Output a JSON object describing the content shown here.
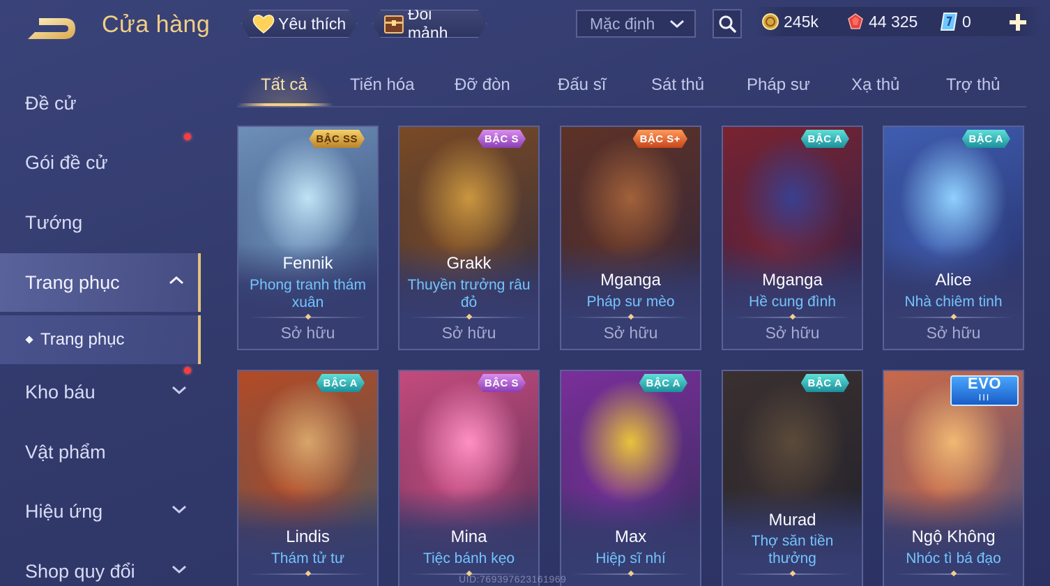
{
  "header": {
    "title": "Cửa hàng",
    "favorite_label": "Yêu thích",
    "shard_exchange_label": "Đổi mảnh",
    "sort_select_value": "Mặc định",
    "currency": {
      "gold": "245k",
      "rubies": "44 325",
      "vouchers": "0"
    }
  },
  "sidebar": {
    "items": [
      {
        "label": "Đề cử"
      },
      {
        "label": "Gói đề cử"
      },
      {
        "label": "Tướng"
      },
      {
        "label": "Trang phục"
      },
      {
        "label": "Kho báu"
      },
      {
        "label": "Vật phẩm"
      },
      {
        "label": "Hiệu ứng"
      },
      {
        "label": "Shop quy đổi"
      }
    ],
    "sub_item": {
      "label": "Trang phục"
    }
  },
  "tabs": [
    {
      "label": "Tất cả",
      "active": true
    },
    {
      "label": "Tiến hóa"
    },
    {
      "label": "Đỡ đòn"
    },
    {
      "label": "Đấu sĩ"
    },
    {
      "label": "Sát thủ"
    },
    {
      "label": "Pháp sư"
    },
    {
      "label": "Xạ thủ"
    },
    {
      "label": "Trợ thủ"
    }
  ],
  "cards": [
    {
      "hero": "Fennik",
      "skin": "Phong tranh thám xuân",
      "skin_l1": "Phong tranh thám",
      "skin_l2": "xuân",
      "tier": "BẬC SS",
      "status": "Sở hữu",
      "palette": [
        "#bfe3f5",
        "#6d8fb8",
        "#2d3f6e"
      ]
    },
    {
      "hero": "Grakk",
      "skin": "Thuyền trưởng râu đỏ",
      "skin_l1": "Thuyền trưởng râu",
      "skin_l2": "đỏ",
      "tier": "BẬC S",
      "status": "Sở hữu",
      "palette": [
        "#c9963f",
        "#7a4a25",
        "#2b2a3e"
      ]
    },
    {
      "hero": "Mganga",
      "skin": "Pháp sư mèo",
      "tier": "BẬC S+",
      "status": "Sở hữu",
      "palette": [
        "#a1613a",
        "#5e3226",
        "#2c2540"
      ]
    },
    {
      "hero": "Mganga",
      "skin": "Hề cung đình",
      "tier": "BẬC A",
      "status": "Sở hữu",
      "palette": [
        "#3a3f8f",
        "#7a2330",
        "#1e2250"
      ]
    },
    {
      "hero": "Alice",
      "skin": "Nhà chiêm tinh",
      "tier": "BẬC A",
      "status": "Sở hữu",
      "palette": [
        "#8fd0ff",
        "#3f5db0",
        "#22285e"
      ]
    },
    {
      "hero": "Lindis",
      "skin": "Thám tử tư",
      "tier": "BẬC A",
      "palette": [
        "#d7a56b",
        "#b44a26",
        "#3d5a63"
      ]
    },
    {
      "hero": "Mina",
      "skin": "Tiệc bánh kẹo",
      "tier": "BẬC S",
      "palette": [
        "#ff8fc3",
        "#c34b7d",
        "#4a2a4f"
      ]
    },
    {
      "hero": "Max",
      "skin": "Hiệp sĩ nhí",
      "tier": "BẬC A",
      "palette": [
        "#e8c23b",
        "#7a2f9a",
        "#2f2b55"
      ]
    },
    {
      "hero": "Murad",
      "skin": "Thợ săn tiền thưởng",
      "skin_l1": "Thợ săn tiền",
      "skin_l2": "thưởng",
      "tier": "BẬC A",
      "palette": [
        "#5a4a3a",
        "#3a3030",
        "#1d1f2a"
      ]
    },
    {
      "hero": "Ngộ Không",
      "skin": "Nhóc tì bá đạo",
      "tier": "EVO",
      "tier_sub": "III",
      "palette": [
        "#f0b873",
        "#c9694a",
        "#3a4a80"
      ]
    }
  ],
  "footer": {
    "uid": "UID:769397623161969"
  },
  "colors": {
    "accent_gold": "#f1cf84",
    "skin_name_blue": "#74c4ff",
    "notification_red": "#ff3b3b"
  }
}
